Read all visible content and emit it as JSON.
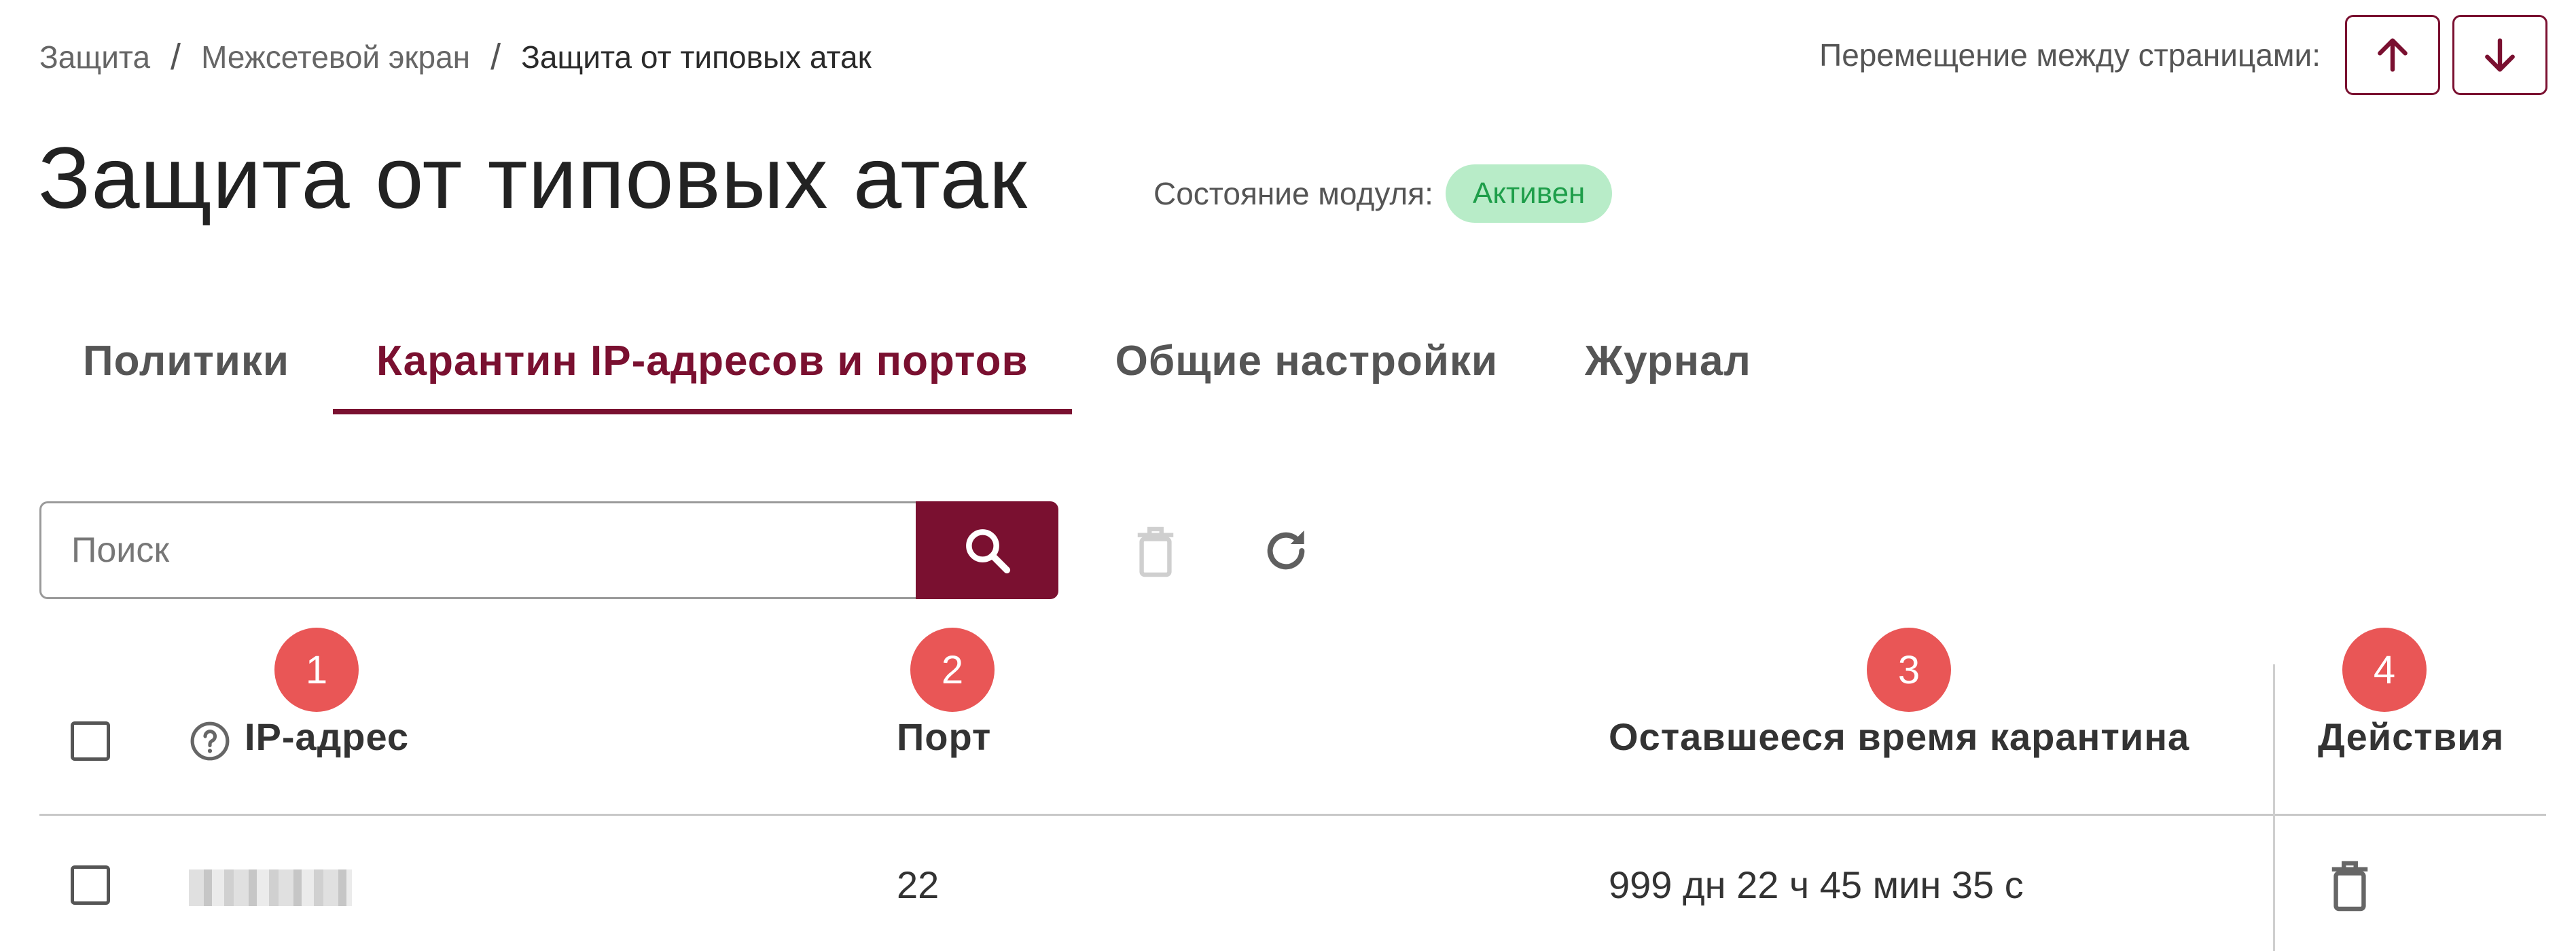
{
  "breadcrumb": {
    "items": [
      "Защита",
      "Межсетевой экран",
      "Защита от типовых атак"
    ],
    "separator": "/"
  },
  "page_nav": {
    "label": "Перемещение между страницами:",
    "up_icon": "arrow-up-icon",
    "down_icon": "arrow-down-icon"
  },
  "title": "Защита от типовых атак",
  "module_state": {
    "label": "Состояние модуля:",
    "value": "Активен",
    "color": "#1e9e4a",
    "background": "#b8ecc8"
  },
  "tabs": [
    {
      "label": "Политики",
      "active": false
    },
    {
      "label": "Карантин IP-адресов и портов",
      "active": true
    },
    {
      "label": "Общие настройки",
      "active": false
    },
    {
      "label": "Журнал",
      "active": false
    }
  ],
  "search": {
    "placeholder": "Поиск",
    "icon": "search-icon"
  },
  "toolbar": {
    "delete_icon": "trash-icon",
    "refresh_icon": "refresh-icon"
  },
  "markers": [
    "1",
    "2",
    "3",
    "4"
  ],
  "table": {
    "columns": [
      "IP-адрес",
      "Порт",
      "Оставшееся время карантина",
      "Действия"
    ],
    "rows": [
      {
        "ip": "",
        "port": "22",
        "time_left": "999 дн 22 ч 45 мин 35 с"
      }
    ]
  },
  "colors": {
    "accent": "#7a1030",
    "marker": "#e95656"
  }
}
